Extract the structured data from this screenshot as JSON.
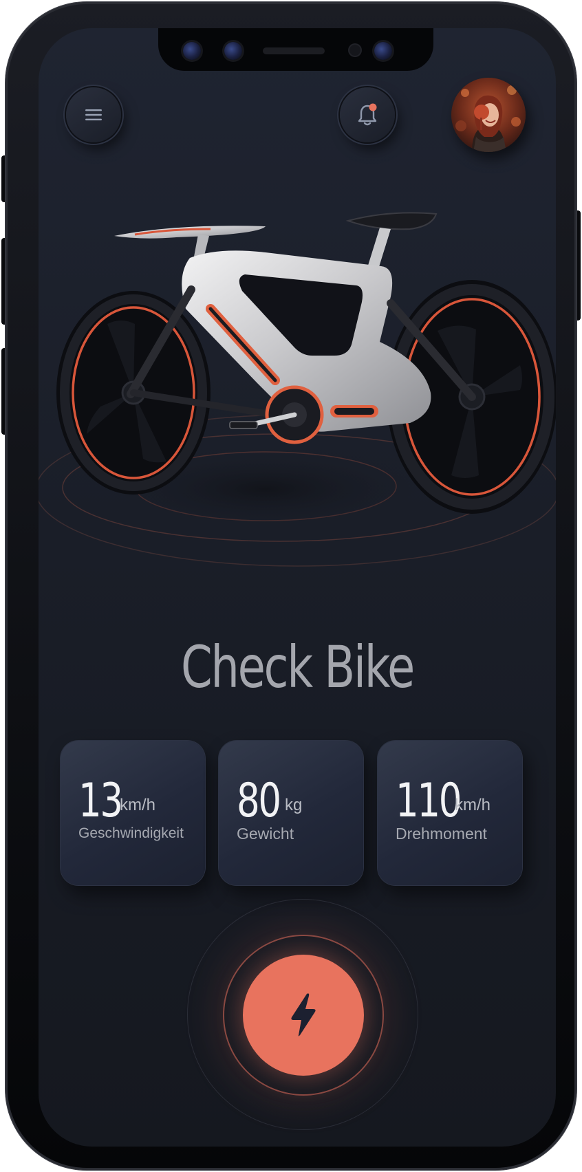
{
  "header": {
    "menu_icon": "hamburger-menu-icon",
    "notification_icon": "bell-icon",
    "notification_dot_color": "#e8735e",
    "avatar": "user-avatar"
  },
  "title": "Check Bike",
  "stats": [
    {
      "value": "13",
      "unit": "km/h",
      "label": "Geschwindigkeit"
    },
    {
      "value": "80",
      "unit": "kg",
      "label": "Gewicht"
    },
    {
      "value": "110",
      "unit": "km/h",
      "label": "Drehmoment"
    }
  ],
  "action": {
    "icon": "lightning-bolt-icon",
    "color": "#e8735e"
  },
  "colors": {
    "background": "#1a1e28",
    "card": "#2a3041",
    "accent": "#e8735e",
    "bike_frame": "#d6d6d8"
  }
}
